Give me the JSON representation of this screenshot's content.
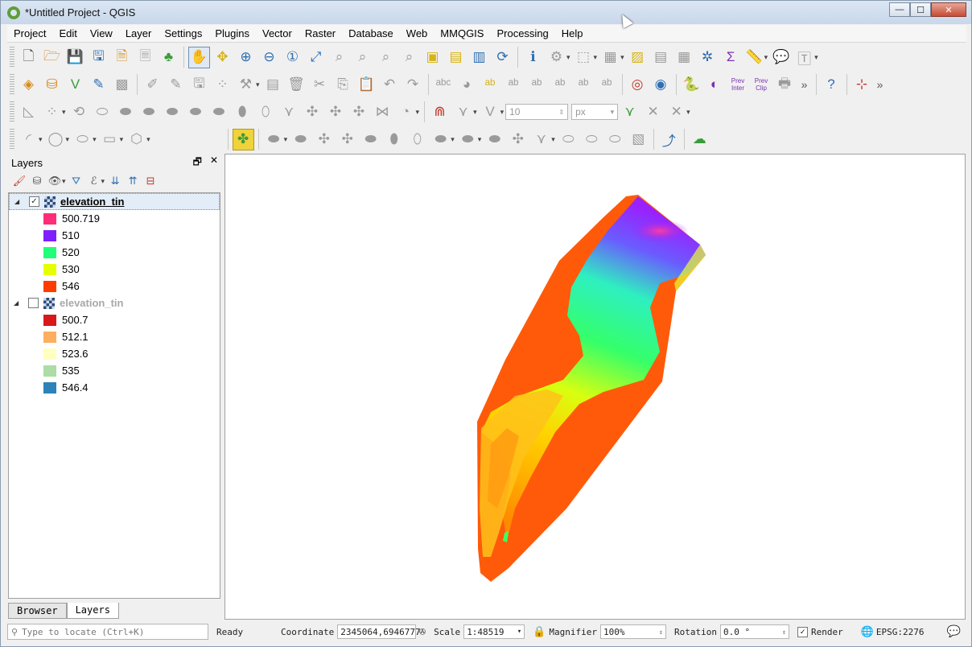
{
  "window": {
    "title": "*Untitled Project - QGIS",
    "controls": {
      "minimize": "—",
      "maximize": "☐",
      "close": "✕"
    }
  },
  "menubar": {
    "items": [
      "Project",
      "Edit",
      "View",
      "Layer",
      "Settings",
      "Plugins",
      "Vector",
      "Raster",
      "Database",
      "Web",
      "MMQGIS",
      "Processing",
      "Help"
    ]
  },
  "toolbar": {
    "tooltip_labels": {
      "prev_inter": "Prev Inter",
      "prev_clip": "Prev Clip"
    },
    "snapping": {
      "tolerance": "10",
      "unit": "px"
    }
  },
  "layers_panel": {
    "title": "Layers",
    "float_icon": "🗗",
    "close_icon": "✕",
    "layers": [
      {
        "name": "elevation_tin",
        "visible": true,
        "check_mark": "✓",
        "expander": "◢",
        "legend": [
          {
            "label": "500.719",
            "color": "#ff2d78"
          },
          {
            "label": "510",
            "color": "#7f1fff"
          },
          {
            "label": "520",
            "color": "#1fff78"
          },
          {
            "label": "530",
            "color": "#e5ff00"
          },
          {
            "label": "546",
            "color": "#ff3c00"
          }
        ]
      },
      {
        "name": "elevation_tin",
        "visible": false,
        "check_mark": "",
        "expander": "◢",
        "legend": [
          {
            "label": "500.7",
            "color": "#d7191c"
          },
          {
            "label": "512.1",
            "color": "#fdae61"
          },
          {
            "label": "523.6",
            "color": "#ffffbf"
          },
          {
            "label": "535",
            "color": "#abdda4"
          },
          {
            "label": "546.4",
            "color": "#2b83ba"
          }
        ]
      }
    ],
    "tabs": [
      "Browser",
      "Layers"
    ]
  },
  "statusbar": {
    "locate_placeholder": "Type to locate (Ctrl+K)",
    "message": "Ready",
    "coordinate_label": "Coordinate",
    "coordinate_value": "2345064,6946777",
    "scale_label": "Scale",
    "scale_value": "1:48519",
    "magnifier_label": "Magnifier",
    "magnifier_value": "100%",
    "rotation_label": "Rotation",
    "rotation_value": "0.0 °",
    "render_label": "Render",
    "render_checked": "✓",
    "crs": "EPSG:2276"
  }
}
